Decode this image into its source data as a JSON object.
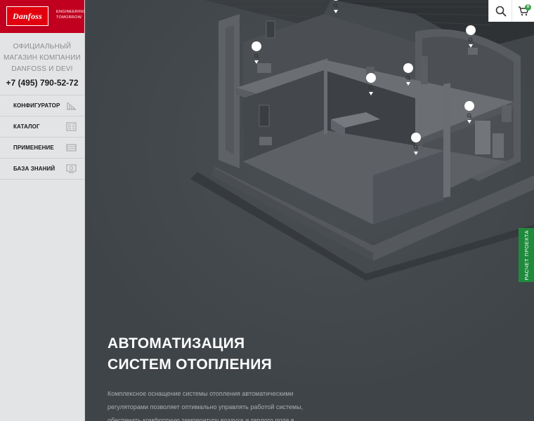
{
  "brand": {
    "logo_text": "Danfoss",
    "tagline_line1": "ENGINEERING",
    "tagline_line2": "TOMORROW",
    "color": "#e2000f"
  },
  "sidebar": {
    "info_line1": "ОФИЦИАЛЬНЫЙ",
    "info_line2": "МАГАЗИН КОМПАНИИ",
    "info_line3": "DANFOSS И DEVI",
    "phone": "+7 (495) 790-52-72",
    "items": [
      {
        "label": "КОНФИГУРАТОР",
        "icon": "chart-icon"
      },
      {
        "label": "КАТАЛОГ",
        "icon": "catalog-icon"
      },
      {
        "label": "ПРИМЕНЕНИЕ",
        "icon": "application-icon"
      },
      {
        "label": "БАЗА ЗНАНИЙ",
        "icon": "knowledge-icon"
      }
    ]
  },
  "header": {
    "search_icon": "search-icon",
    "cart_icon": "cart-icon",
    "cart_count": "0",
    "accent": "#3ca24a"
  },
  "hero": {
    "title_line1": "АВТОМАТИЗАЦИЯ",
    "title_line2": "СИСТЕМ ОТОПЛЕНИЯ",
    "text_line1": "Комплексное оснащение системы отопления автоматическими",
    "text_line2": "регуляторами позволяет оптимально управлять работой системы,",
    "text_line3": "обеспечить комфортную температуру воздуха и теплого пола в"
  },
  "project_tab": {
    "label": "РАСЧЕТ ПРОЕКТА",
    "color": "#1f8a3c"
  },
  "house": {
    "markers": 7,
    "marker_icon": "zoom-pin-icon"
  }
}
